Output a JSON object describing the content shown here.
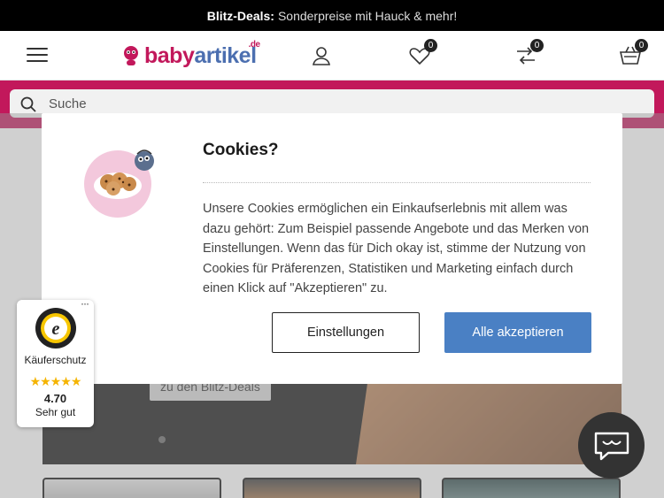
{
  "promo": {
    "highlight": "Blitz-Deals:",
    "text": "Sonderpreise mit Hauck & mehr!"
  },
  "header": {
    "logo_main": "baby",
    "logo_accent": "artikel",
    "logo_tld": ".de",
    "wishlist_count": "0",
    "compare_count": "0",
    "cart_count": "0"
  },
  "search": {
    "placeholder": "Suche"
  },
  "banner": {
    "button_label": "zu den Blitz-Deals"
  },
  "cookie_modal": {
    "title": "Cookies?",
    "text": "Unsere Cookies ermöglichen ein Einkaufserlebnis mit allem was dazu gehört: Zum Beispiel passende Angebote und das Merken von Einstellungen. Wenn das für Dich okay ist, stimme der Nutzung von Cookies für Präferenzen, Statistiken und Marketing einfach durch einen Klick auf \"Akzeptieren\" zu.",
    "settings_label": "Einstellungen",
    "accept_label": "Alle akzeptieren"
  },
  "trust_badge": {
    "more": "···",
    "label": "Käuferschutz",
    "stars": "★★★★★",
    "rating": "4.70",
    "rating_text": "Sehr gut"
  },
  "colors": {
    "brand_pink": "#c2185b",
    "brand_blue": "#4c6fb0",
    "accept_blue": "#4a80c4"
  },
  "icons": [
    "menu-icon",
    "user-icon",
    "heart-icon",
    "compare-icon",
    "cart-icon",
    "search-icon",
    "chat-icon",
    "cookie-plate-icon",
    "trusted-shops-seal-icon"
  ]
}
